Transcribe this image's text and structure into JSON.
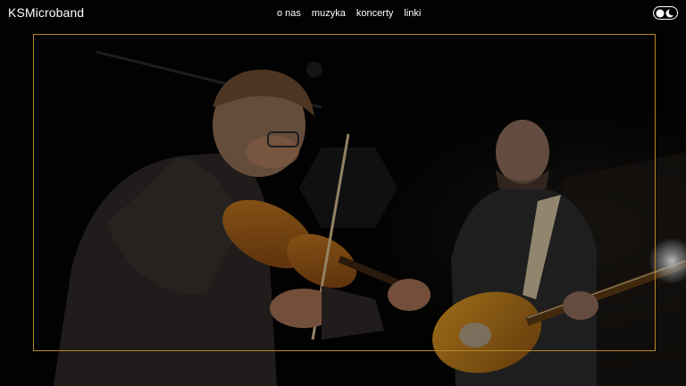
{
  "header": {
    "brand": "KSMicroband",
    "nav": [
      {
        "label": "o nas"
      },
      {
        "label": "muzyka"
      },
      {
        "label": "koncerty"
      },
      {
        "label": "linki"
      }
    ],
    "theme_toggle_icon": "day-night-toggle-icon"
  },
  "hero": {
    "image": "band-performance-photo",
    "frame_color": "#b8862a"
  },
  "colors": {
    "background": "#000000",
    "text": "#ffffff",
    "accent": "#b8862a"
  }
}
